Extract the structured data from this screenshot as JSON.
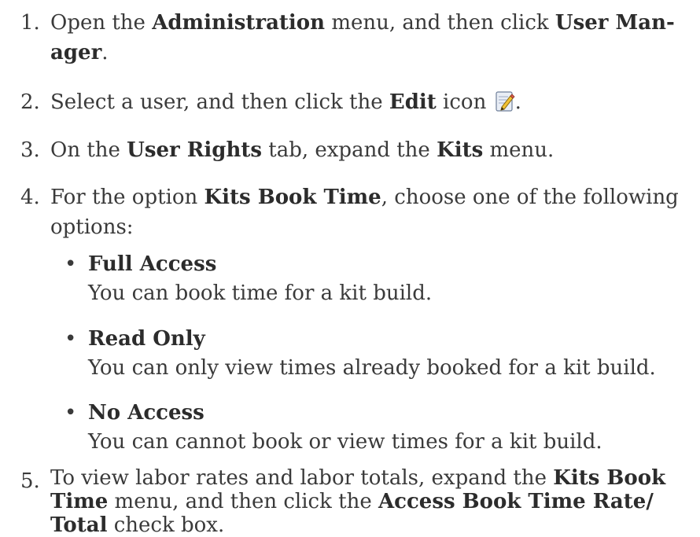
{
  "steps": [
    {
      "num": "1.",
      "line1": [
        "Open the ",
        "Administration",
        " menu, and then click ",
        "User Man-"
      ],
      "line2": [
        "ager",
        "."
      ]
    },
    {
      "num": "2.",
      "parts": [
        "Select a user, and then click the ",
        "Edit",
        " icon",
        "."
      ],
      "icon": "edit-pencil-icon"
    },
    {
      "num": "3.",
      "parts": [
        "On the ",
        "User Rights",
        " tab, expand the ",
        "Kits",
        " menu."
      ]
    },
    {
      "num": "4.",
      "line1": [
        "For the option ",
        "Kits Book Time",
        ", choose one of the following"
      ],
      "line2": "options:"
    },
    {
      "num": "5.",
      "line1": [
        "To view labor rates and labor totals, expand the ",
        "Kits Book"
      ],
      "line2": [
        "Time",
        " menu, and then click the ",
        "Access Book Time Rate/"
      ],
      "line3": [
        "Total",
        " check box."
      ]
    }
  ],
  "options": [
    {
      "bullet": "•",
      "title": "Full Access",
      "desc": "You can book time for a kit build."
    },
    {
      "bullet": "•",
      "title": "Read Only",
      "desc": "You can only view times already booked for a kit build."
    },
    {
      "bullet": "•",
      "title": "No Access",
      "desc": "You can cannot book or view times for a kit build."
    }
  ]
}
